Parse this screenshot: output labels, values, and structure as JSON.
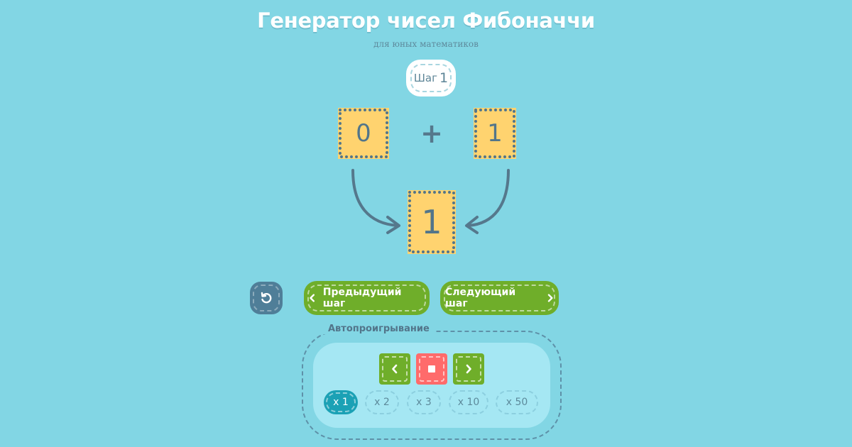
{
  "header": {
    "title": "Генератор чисел Фибоначчи",
    "subtitle": "для юных математиков"
  },
  "step": {
    "label": "Шаг",
    "number": "1"
  },
  "equation": {
    "left_operand": "0",
    "operator": "+",
    "right_operand": "1",
    "result": "1"
  },
  "controls": {
    "reset_icon": "restart-icon",
    "prev_label": "Предыдущий шаг",
    "next_label": "Следующий шаг"
  },
  "autoplay": {
    "label": "Автопроигрывание",
    "buttons": [
      "play-backward-icon",
      "stop-icon",
      "play-forward-icon"
    ],
    "speeds": [
      "x 1",
      "x 2",
      "x 3",
      "x 10",
      "x 50"
    ],
    "selected_speed": "x 1"
  },
  "colors": {
    "background": "#82d6e4",
    "card": "#ffd36f",
    "accent_green": "#6fae2a",
    "stop_red": "#ff6b6b",
    "active_speed": "#1ba1b5",
    "reset_button": "#4f7e98"
  }
}
